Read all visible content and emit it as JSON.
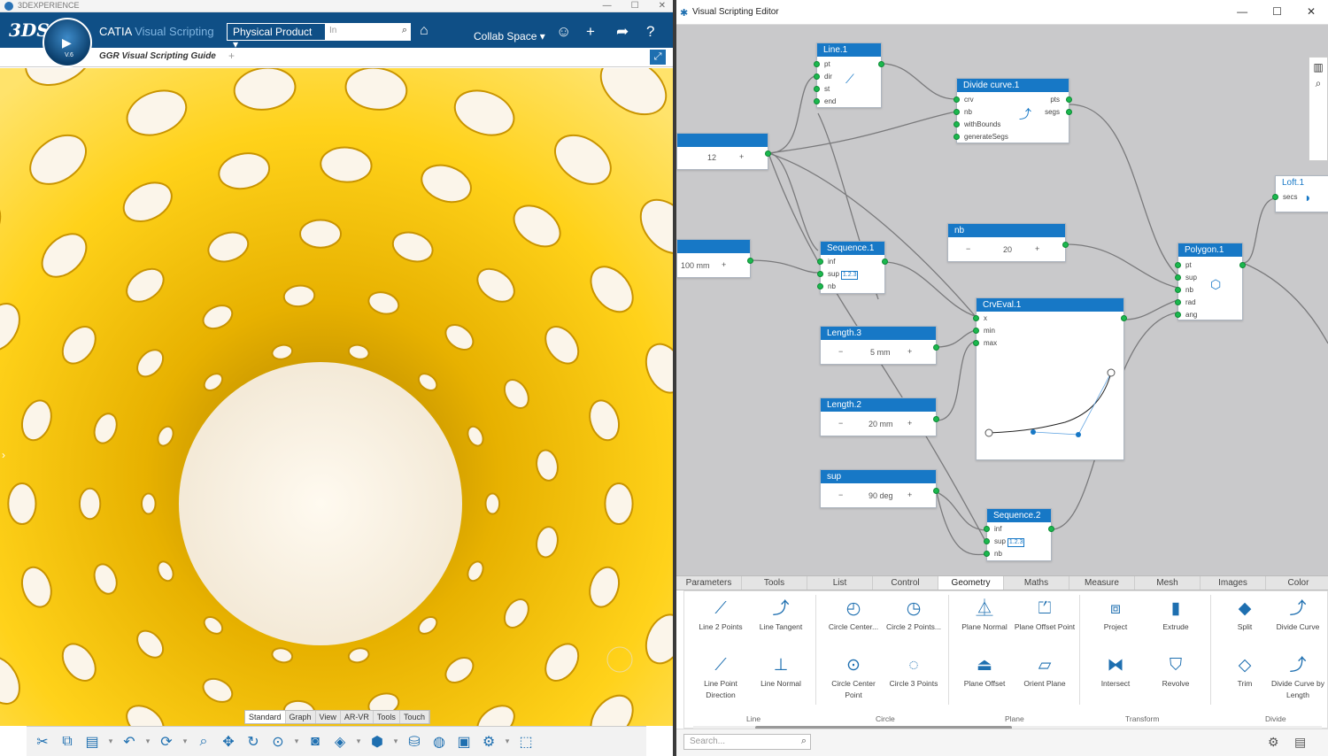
{
  "left_window": {
    "title": "3DEXPERIENCE",
    "window_controls": [
      "—",
      "☐",
      "✕"
    ],
    "brand_logo": "3DS",
    "compass_version": "V.6",
    "app_name": "CATIA",
    "app_subtitle": "Visual Scripting",
    "product_select": "Physical Product",
    "search_placeholder": "In",
    "collab_space": "Collab Space",
    "document_tab": "GGR Visual Scripting Guide",
    "mode_tabs": [
      "Standard",
      "Graph",
      "View",
      "AR-VR",
      "Tools",
      "Touch"
    ],
    "icons": {
      "search": "search-tag-icon",
      "tag": "tag-icon",
      "user": "user-icon",
      "add": "plus-icon",
      "share": "share-icon",
      "help": "help-icon"
    }
  },
  "right_window": {
    "title": "Visual Scripting Editor",
    "window_controls": [
      "—",
      "☐",
      "✕"
    ],
    "nodes": {
      "line1": {
        "title": "Line.1",
        "ports": [
          "pt",
          "dir",
          "st",
          "end"
        ]
      },
      "divide": {
        "title": "Divide curve.1",
        "inputs": [
          "crv",
          "nb",
          "withBounds",
          "generateSegs"
        ],
        "outputs": [
          "pts",
          "segs"
        ]
      },
      "param12": {
        "value": "12",
        "plus": "+"
      },
      "param100": {
        "value": "100 mm",
        "plus": "+"
      },
      "sequence1": {
        "title": "Sequence.1",
        "ports": [
          "inf",
          "sup",
          "nb"
        ],
        "badge": "1.2.3"
      },
      "nb": {
        "title": "nb",
        "minus": "−",
        "value": "20",
        "plus": "+"
      },
      "crveval": {
        "title": "CrvEval.1",
        "ports": [
          "x",
          "min",
          "max"
        ]
      },
      "length3": {
        "title": "Length.3",
        "minus": "−",
        "value": "5 mm",
        "plus": "+"
      },
      "length2": {
        "title": "Length.2",
        "minus": "−",
        "value": "20 mm",
        "plus": "+"
      },
      "sup": {
        "title": "sup",
        "minus": "−",
        "value": "90 deg",
        "plus": "+"
      },
      "sequence2": {
        "title": "Sequence.2",
        "ports": [
          "inf",
          "sup",
          "nb"
        ],
        "badge": "1.2.3"
      },
      "polygon": {
        "title": "Polygon.1",
        "ports": [
          "pt",
          "sup",
          "nb",
          "rad",
          "ang"
        ]
      },
      "loft": {
        "title": "Loft.1",
        "ports": [
          "secs"
        ]
      }
    },
    "categories": [
      "Parameters",
      "Tools",
      "List",
      "Control",
      "Geometry",
      "Maths",
      "Measure",
      "Mesh",
      "Images",
      "Color"
    ],
    "active_category": "Geometry",
    "tools": [
      {
        "label": "Line 2 Points",
        "icon": "line-icon"
      },
      {
        "label": "Line Tangent",
        "icon": "line-tangent-icon"
      },
      {
        "label": "Line Point Direction",
        "icon": "line-direction-icon"
      },
      {
        "label": "Line Normal",
        "icon": "line-normal-icon"
      },
      {
        "label": "Circle Center...",
        "icon": "circle-center-icon"
      },
      {
        "label": "Circle 2 Points...",
        "icon": "circle-2points-icon"
      },
      {
        "label": "Circle Center Point",
        "icon": "circle-center-point-icon"
      },
      {
        "label": "Circle 3 Points",
        "icon": "circle-3points-icon"
      },
      {
        "label": "Plane Normal",
        "icon": "plane-normal-icon"
      },
      {
        "label": "Plane Offset Point",
        "icon": "plane-offset-point-icon"
      },
      {
        "label": "Plane Offset",
        "icon": "plane-offset-icon"
      },
      {
        "label": "Orient Plane",
        "icon": "orient-plane-icon"
      },
      {
        "label": "Project",
        "icon": "project-icon"
      },
      {
        "label": "Extrude",
        "icon": "extrude-icon"
      },
      {
        "label": "Intersect",
        "icon": "intersect-icon"
      },
      {
        "label": "Revolve",
        "icon": "revolve-icon"
      },
      {
        "label": "Split",
        "icon": "split-icon"
      },
      {
        "label": "Divide Curve",
        "icon": "divide-curve-icon"
      },
      {
        "label": "Trim",
        "icon": "trim-icon"
      },
      {
        "label": "Divide Curve by Length",
        "icon": "divide-length-icon"
      }
    ],
    "tool_groups": [
      "Line",
      "Circle",
      "Plane",
      "Transform",
      "Divide"
    ],
    "search_placeholder": "Search..."
  },
  "colors": {
    "header_blue": "#1778c6",
    "catia_bar": "#0f4f86",
    "port_green": "#1bb84e",
    "model_yellow": "#f4c000"
  }
}
